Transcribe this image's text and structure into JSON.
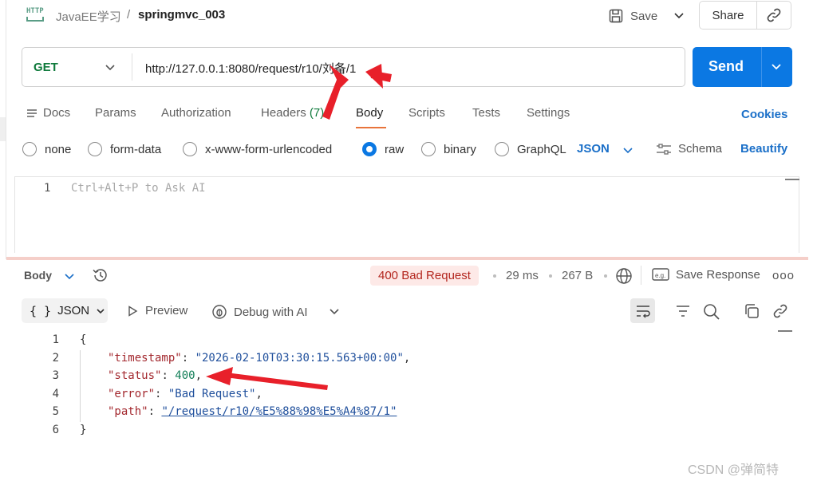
{
  "header": {
    "icon": "http-icon",
    "icon_text": "HTTP",
    "collection": "JavaEE学习",
    "separator": "/",
    "request_name": "springmvc_003",
    "save_label": "Save",
    "share_label": "Share"
  },
  "request": {
    "method": "GET",
    "url": "http://127.0.0.1:8080/request/r10/刘备/1",
    "send_label": "Send"
  },
  "tabs": {
    "docs": "Docs",
    "params": "Params",
    "authorization": "Authorization",
    "headers": "Headers",
    "headers_count": "(7)",
    "body": "Body",
    "scripts": "Scripts",
    "tests": "Tests",
    "settings": "Settings",
    "cookies": "Cookies"
  },
  "body_types": {
    "none": "none",
    "form_data": "form-data",
    "urlencoded": "x-www-form-urlencoded",
    "raw": "raw",
    "binary": "binary",
    "graphql": "GraphQL",
    "selected": "raw",
    "format": "JSON",
    "schema": "Schema",
    "beautify": "Beautify"
  },
  "editor": {
    "line_number": "1",
    "placeholder": "Ctrl+Alt+P to Ask AI"
  },
  "response": {
    "section_label": "Body",
    "status": "400 Bad Request",
    "time": "29 ms",
    "size": "267 B",
    "save_response": "Save Response",
    "more": "ooo",
    "format_label": "JSON",
    "format_glyph": "{ }",
    "preview": "Preview",
    "debug": "Debug with AI",
    "code_lines": {
      "l1": "{",
      "l2_key": "\"timestamp\"",
      "l2_val": "\"2026-02-10T03:30:15.563+00:00\"",
      "l3_key": "\"status\"",
      "l3_val": "400",
      "l4_key": "\"error\"",
      "l4_val": "\"Bad Request\"",
      "l5_key": "\"path\"",
      "l5_val": "\"/request/r10/%E5%88%98%E5%A4%87/1\"",
      "l6": "}"
    },
    "line_numbers": [
      "1",
      "2",
      "3",
      "4",
      "5",
      "6"
    ]
  },
  "colors": {
    "send": "#0b78e3",
    "method": "#0f7a3c",
    "link": "#1a6fc8",
    "tab_active": "#e8743b",
    "status_bg": "#fde9e7",
    "status_text": "#b3261e",
    "annotation_arrow": "#e8202a"
  },
  "watermark": "CSDN @弹简特"
}
